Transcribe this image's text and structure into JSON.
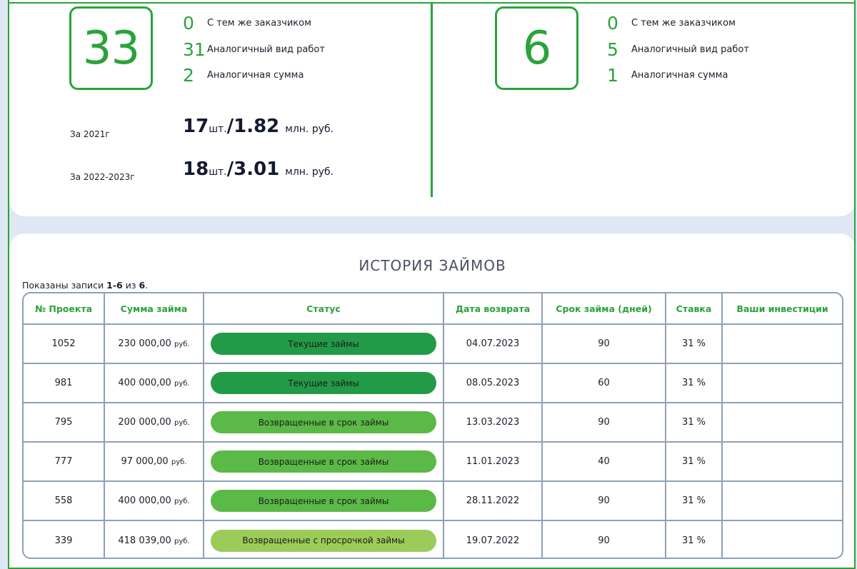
{
  "summary": {
    "left": {
      "total": "33",
      "stats": [
        {
          "num": "0",
          "label": "С тем же заказчиком"
        },
        {
          "num": "31",
          "label": "Аналогичный вид работ"
        },
        {
          "num": "2",
          "label": "Аналогичная сумма"
        }
      ],
      "years": [
        {
          "label": "За 2021г",
          "count": "17",
          "count_unit": "шт.",
          "sum": "1.82",
          "sum_unit": "млн. руб."
        },
        {
          "label": "За 2022-2023г",
          "count": "18",
          "count_unit": "шт.",
          "sum": "3.01",
          "sum_unit": "млн. руб."
        }
      ]
    },
    "right": {
      "total": "6",
      "stats": [
        {
          "num": "0",
          "label": "С тем же заказчиком"
        },
        {
          "num": "5",
          "label": "Аналогичный вид работ"
        },
        {
          "num": "1",
          "label": "Аналогичная сумма"
        }
      ]
    }
  },
  "history": {
    "title": "ИСТОРИЯ ЗАЙМОВ",
    "shown_prefix": "Показаны записи ",
    "shown_range": "1-6",
    "shown_mid": " из ",
    "shown_total": "6",
    "shown_suffix": ".",
    "columns": [
      "№ Проекта",
      "Сумма займа",
      "Статус",
      "Дата возврата",
      "Срок займа (дней)",
      "Ставка",
      "Ваши инвестиции"
    ],
    "currency": "руб.",
    "rows": [
      {
        "project": "1052",
        "amount": "230 000,00",
        "status": "Текущие займы",
        "status_color": "#239a47",
        "date": "04.07.2023",
        "term": "90",
        "rate": "31 %",
        "invest": ""
      },
      {
        "project": "981",
        "amount": "400 000,00",
        "status": "Текущие займы",
        "status_color": "#239a47",
        "date": "08.05.2023",
        "term": "60",
        "rate": "31 %",
        "invest": ""
      },
      {
        "project": "795",
        "amount": "200 000,00",
        "status": "Возвращенные в срок займы",
        "status_color": "#5bba47",
        "date": "13.03.2023",
        "term": "90",
        "rate": "31 %",
        "invest": ""
      },
      {
        "project": "777",
        "amount": "97 000,00",
        "status": "Возвращенные в срок займы",
        "status_color": "#5bba47",
        "date": "11.01.2023",
        "term": "40",
        "rate": "31 %",
        "invest": ""
      },
      {
        "project": "558",
        "amount": "400 000,00",
        "status": "Возвращенные в срок займы",
        "status_color": "#5bba47",
        "date": "28.11.2022",
        "term": "90",
        "rate": "31 %",
        "invest": ""
      },
      {
        "project": "339",
        "amount": "418 039,00",
        "status": "Возвращенные с просрочкой займы",
        "status_color": "#9bcc5a",
        "date": "19.07.2022",
        "term": "90",
        "rate": "31 %",
        "invest": ""
      }
    ]
  }
}
